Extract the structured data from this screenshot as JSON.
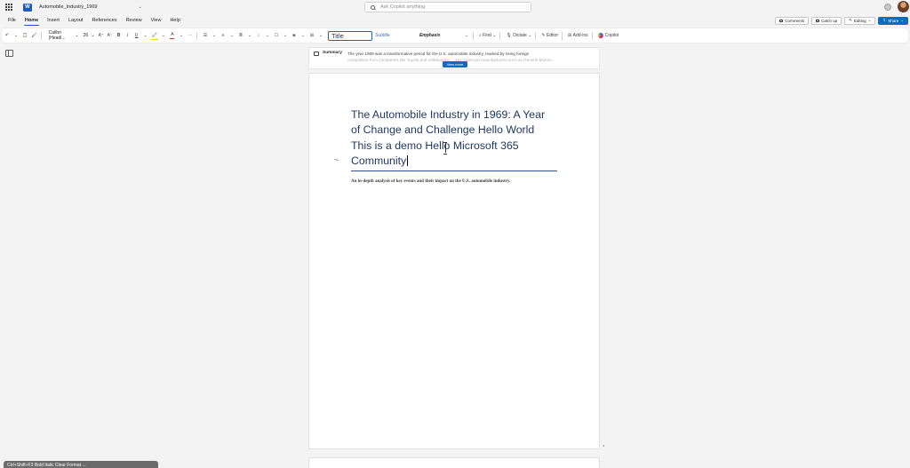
{
  "titlebar": {
    "doc_title": "Automobile_Industry_1969",
    "search_placeholder": "Ask Copilot anything",
    "logo_letter": "W"
  },
  "menubar": {
    "items": [
      "File",
      "Home",
      "Insert",
      "Layout",
      "References",
      "Review",
      "View",
      "Help"
    ],
    "active": "Home",
    "comments_label": "Comments",
    "catchup_label": "Catch up",
    "editing_label": "Editing",
    "share_label": "Share"
  },
  "ribbon": {
    "font_name": "Calibri (Headi...",
    "font_size": "26",
    "style_title": "Title",
    "style_subtitle": "Subtitle",
    "style_emphasis": "Emphasis",
    "find_label": "Find",
    "dictate_label": "Dictate",
    "editor_label": "Editor",
    "addins_label": "Add-ins",
    "copilot_label": "Copilot"
  },
  "summary": {
    "label": "Summary",
    "line1": "The year 1969 was a transformative period for the U.S. automobile industry, marked by rising foreign",
    "line2": "competition from companies like Toyota and Volkswagen ... key American manufacturers such as General Motors...",
    "view_more_label": "View more"
  },
  "document": {
    "heading_line1": "The Automobile Industry in 1969: A Year",
    "heading_line2": "of Change and Challenge Hello World",
    "heading_line3": "This is a demo Hello Microsoft 365",
    "heading_line4": "Community",
    "subtitle": "An in-depth analysis of key events and their impact on the U.S. automobile industry."
  },
  "statusbar": {
    "text": "Ctrl+Shift+F3  Bold  Italic  Clear  Format  ..."
  }
}
